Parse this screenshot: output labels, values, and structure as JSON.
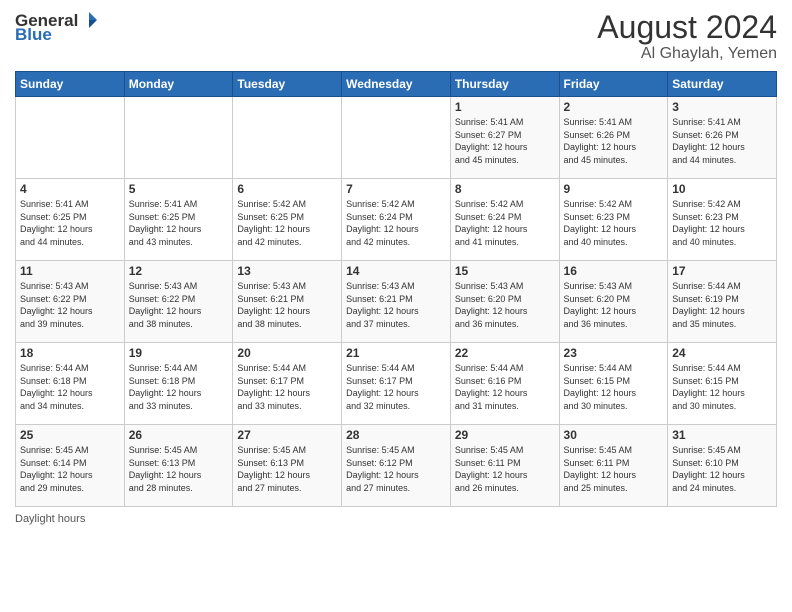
{
  "header": {
    "logo_general": "General",
    "logo_blue": "Blue",
    "main_title": "August 2024",
    "sub_title": "Al Ghaylah, Yemen"
  },
  "days_of_week": [
    "Sunday",
    "Monday",
    "Tuesday",
    "Wednesday",
    "Thursday",
    "Friday",
    "Saturday"
  ],
  "weeks": [
    [
      {
        "day": "",
        "info": ""
      },
      {
        "day": "",
        "info": ""
      },
      {
        "day": "",
        "info": ""
      },
      {
        "day": "",
        "info": ""
      },
      {
        "day": "1",
        "info": "Sunrise: 5:41 AM\nSunset: 6:27 PM\nDaylight: 12 hours\nand 45 minutes."
      },
      {
        "day": "2",
        "info": "Sunrise: 5:41 AM\nSunset: 6:26 PM\nDaylight: 12 hours\nand 45 minutes."
      },
      {
        "day": "3",
        "info": "Sunrise: 5:41 AM\nSunset: 6:26 PM\nDaylight: 12 hours\nand 44 minutes."
      }
    ],
    [
      {
        "day": "4",
        "info": "Sunrise: 5:41 AM\nSunset: 6:25 PM\nDaylight: 12 hours\nand 44 minutes."
      },
      {
        "day": "5",
        "info": "Sunrise: 5:41 AM\nSunset: 6:25 PM\nDaylight: 12 hours\nand 43 minutes."
      },
      {
        "day": "6",
        "info": "Sunrise: 5:42 AM\nSunset: 6:25 PM\nDaylight: 12 hours\nand 42 minutes."
      },
      {
        "day": "7",
        "info": "Sunrise: 5:42 AM\nSunset: 6:24 PM\nDaylight: 12 hours\nand 42 minutes."
      },
      {
        "day": "8",
        "info": "Sunrise: 5:42 AM\nSunset: 6:24 PM\nDaylight: 12 hours\nand 41 minutes."
      },
      {
        "day": "9",
        "info": "Sunrise: 5:42 AM\nSunset: 6:23 PM\nDaylight: 12 hours\nand 40 minutes."
      },
      {
        "day": "10",
        "info": "Sunrise: 5:42 AM\nSunset: 6:23 PM\nDaylight: 12 hours\nand 40 minutes."
      }
    ],
    [
      {
        "day": "11",
        "info": "Sunrise: 5:43 AM\nSunset: 6:22 PM\nDaylight: 12 hours\nand 39 minutes."
      },
      {
        "day": "12",
        "info": "Sunrise: 5:43 AM\nSunset: 6:22 PM\nDaylight: 12 hours\nand 38 minutes."
      },
      {
        "day": "13",
        "info": "Sunrise: 5:43 AM\nSunset: 6:21 PM\nDaylight: 12 hours\nand 38 minutes."
      },
      {
        "day": "14",
        "info": "Sunrise: 5:43 AM\nSunset: 6:21 PM\nDaylight: 12 hours\nand 37 minutes."
      },
      {
        "day": "15",
        "info": "Sunrise: 5:43 AM\nSunset: 6:20 PM\nDaylight: 12 hours\nand 36 minutes."
      },
      {
        "day": "16",
        "info": "Sunrise: 5:43 AM\nSunset: 6:20 PM\nDaylight: 12 hours\nand 36 minutes."
      },
      {
        "day": "17",
        "info": "Sunrise: 5:44 AM\nSunset: 6:19 PM\nDaylight: 12 hours\nand 35 minutes."
      }
    ],
    [
      {
        "day": "18",
        "info": "Sunrise: 5:44 AM\nSunset: 6:18 PM\nDaylight: 12 hours\nand 34 minutes."
      },
      {
        "day": "19",
        "info": "Sunrise: 5:44 AM\nSunset: 6:18 PM\nDaylight: 12 hours\nand 33 minutes."
      },
      {
        "day": "20",
        "info": "Sunrise: 5:44 AM\nSunset: 6:17 PM\nDaylight: 12 hours\nand 33 minutes."
      },
      {
        "day": "21",
        "info": "Sunrise: 5:44 AM\nSunset: 6:17 PM\nDaylight: 12 hours\nand 32 minutes."
      },
      {
        "day": "22",
        "info": "Sunrise: 5:44 AM\nSunset: 6:16 PM\nDaylight: 12 hours\nand 31 minutes."
      },
      {
        "day": "23",
        "info": "Sunrise: 5:44 AM\nSunset: 6:15 PM\nDaylight: 12 hours\nand 30 minutes."
      },
      {
        "day": "24",
        "info": "Sunrise: 5:44 AM\nSunset: 6:15 PM\nDaylight: 12 hours\nand 30 minutes."
      }
    ],
    [
      {
        "day": "25",
        "info": "Sunrise: 5:45 AM\nSunset: 6:14 PM\nDaylight: 12 hours\nand 29 minutes."
      },
      {
        "day": "26",
        "info": "Sunrise: 5:45 AM\nSunset: 6:13 PM\nDaylight: 12 hours\nand 28 minutes."
      },
      {
        "day": "27",
        "info": "Sunrise: 5:45 AM\nSunset: 6:13 PM\nDaylight: 12 hours\nand 27 minutes."
      },
      {
        "day": "28",
        "info": "Sunrise: 5:45 AM\nSunset: 6:12 PM\nDaylight: 12 hours\nand 27 minutes."
      },
      {
        "day": "29",
        "info": "Sunrise: 5:45 AM\nSunset: 6:11 PM\nDaylight: 12 hours\nand 26 minutes."
      },
      {
        "day": "30",
        "info": "Sunrise: 5:45 AM\nSunset: 6:11 PM\nDaylight: 12 hours\nand 25 minutes."
      },
      {
        "day": "31",
        "info": "Sunrise: 5:45 AM\nSunset: 6:10 PM\nDaylight: 12 hours\nand 24 minutes."
      }
    ]
  ],
  "footer": {
    "daylight_label": "Daylight hours"
  }
}
